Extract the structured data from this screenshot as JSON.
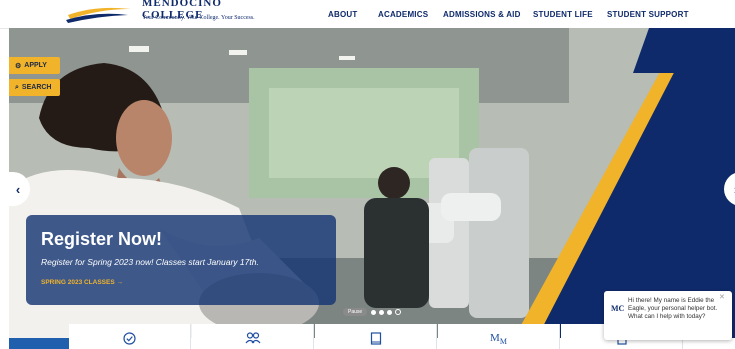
{
  "header": {
    "logo_name": "MENDOCINO COLLEGE",
    "logo_tagline": "Your Community. Your College. Your Success.",
    "nav": [
      "ABOUT",
      "ACADEMICS",
      "ADMISSIONS & AID",
      "STUDENT LIFE",
      "STUDENT SUPPORT"
    ]
  },
  "side_buttons": {
    "apply": {
      "icon": "gear-icon",
      "label": "APPLY"
    },
    "search": {
      "icon": "search-icon",
      "label": "SEARCH"
    }
  },
  "hero": {
    "title": "Register Now!",
    "subtitle": "Register for Spring 2023 now! Classes start January 17th.",
    "link": "SPRING 2023 CLASSES",
    "pause_label": "Pause",
    "slides_count": 4,
    "active_slide": 1
  },
  "carousel": {
    "prev_icon": "chevron-left-icon",
    "next_icon": "chevron-right-icon"
  },
  "quick_links": {
    "icons": [
      "check-circle-icon",
      "people-icon",
      "book-icon",
      "mm-logo-icon",
      "document-icon"
    ]
  },
  "chat": {
    "avatar": "MC",
    "message": "Hi there! My name is Eddie the Eagle, your personal helper bot. What can I help with today?",
    "close_icon": "close-icon"
  },
  "colors": {
    "navy": "#0f2a6b",
    "gold": "#f0b32a",
    "promo_bg": "#163674",
    "link_blue": "#1f4f9f"
  }
}
